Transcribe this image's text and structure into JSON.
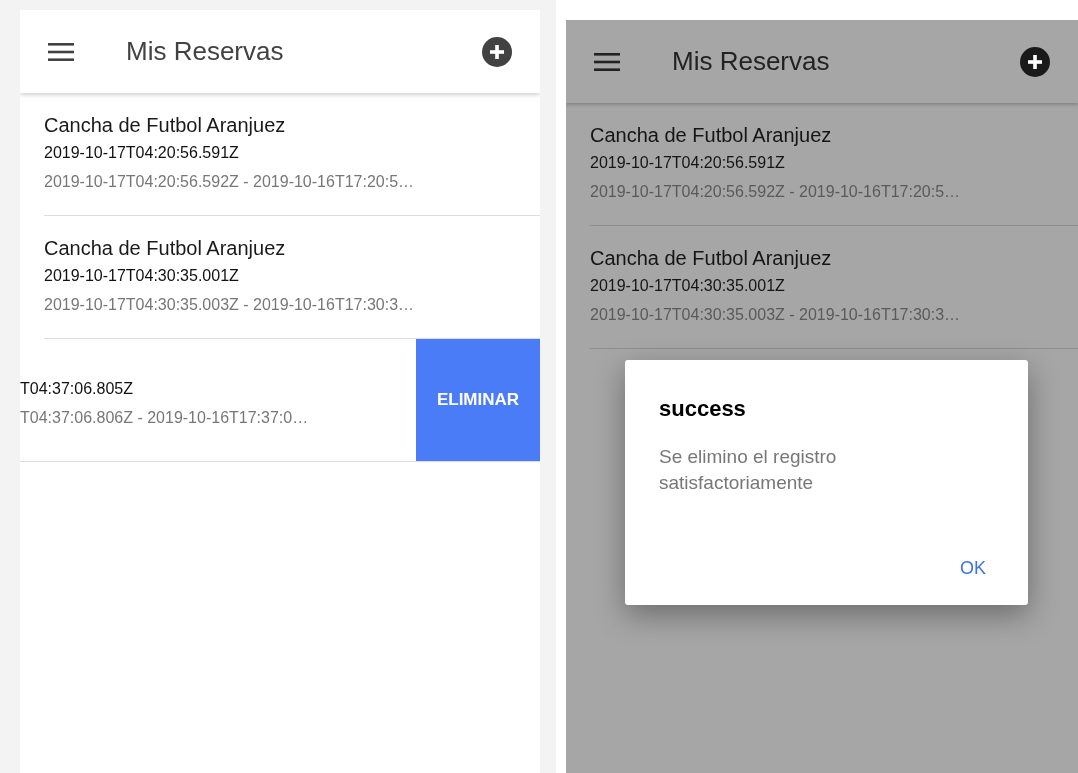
{
  "screens": [
    {
      "dimmed": false,
      "header": {
        "title": "Mis Reservas"
      },
      "items": [
        {
          "title": "Cancha de Futbol Aranjuez",
          "subtitle": "2019-10-17T04:20:56.591Z",
          "detail": "2019-10-17T04:20:56.592Z - 2019-10-16T17:20:5…",
          "swiped": false
        },
        {
          "title": "Cancha de Futbol Aranjuez",
          "subtitle": "2019-10-17T04:30:35.001Z",
          "detail": "2019-10-17T04:30:35.003Z - 2019-10-16T17:30:3…",
          "swiped": false
        },
        {
          "subtitle": "T04:37:06.805Z",
          "detail": "T04:37:06.806Z - 2019-10-16T17:37:0…",
          "swiped": true,
          "action": "ELIMINAR"
        }
      ]
    },
    {
      "dimmed": true,
      "header": {
        "title": "Mis Reservas"
      },
      "items": [
        {
          "title": "Cancha de Futbol Aranjuez",
          "subtitle": "2019-10-17T04:20:56.591Z",
          "detail": "2019-10-17T04:20:56.592Z - 2019-10-16T17:20:5…",
          "swiped": false
        },
        {
          "title": "Cancha de Futbol Aranjuez",
          "subtitle": "2019-10-17T04:30:35.001Z",
          "detail": "2019-10-17T04:30:35.003Z - 2019-10-16T17:30:3…",
          "swiped": false
        }
      ],
      "dialog": {
        "title": "success",
        "message": "Se elimino el registro satisfactoriamente",
        "button": "OK"
      }
    }
  ]
}
